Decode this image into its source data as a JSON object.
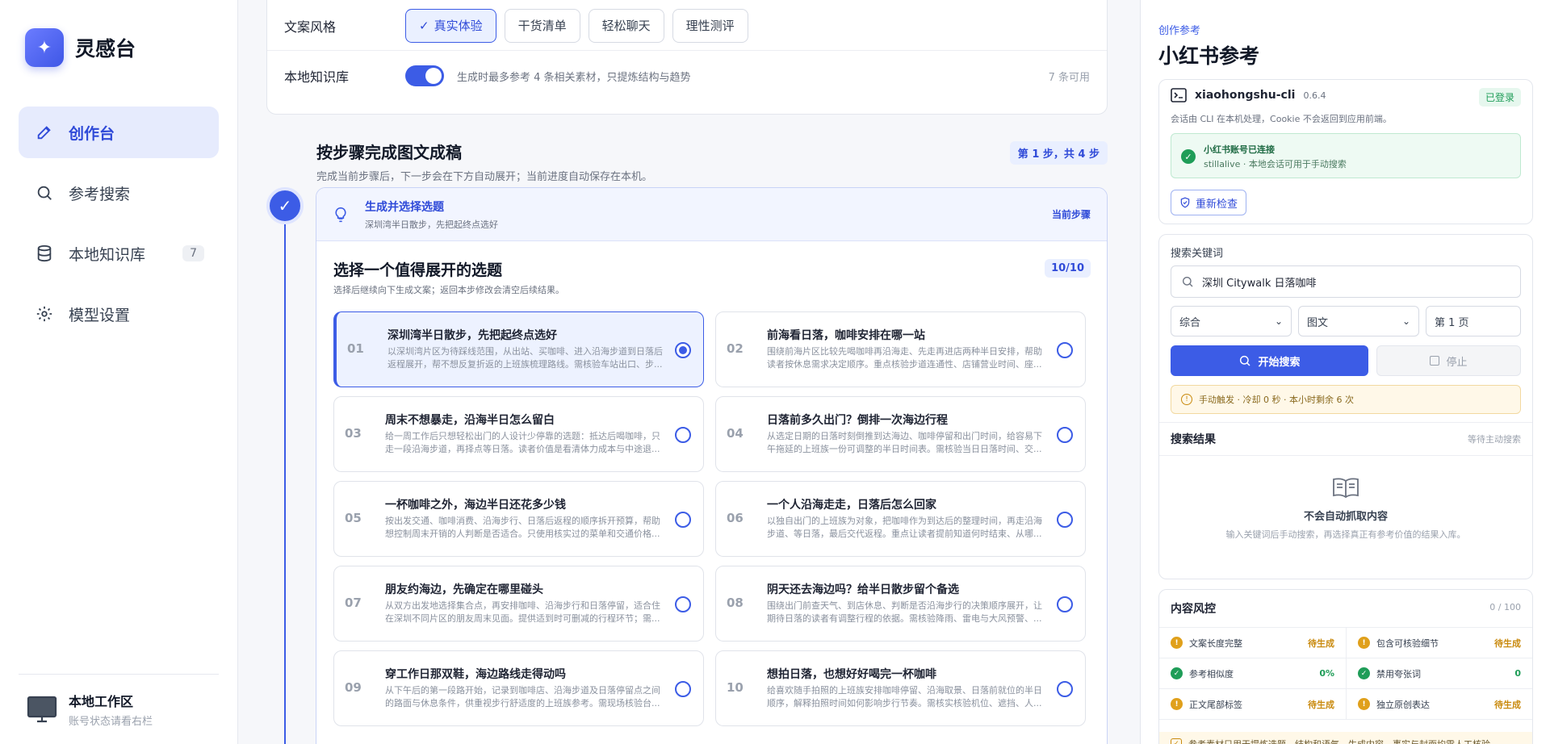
{
  "sidebar": {
    "brand": "灵感台",
    "items": [
      {
        "label": "创作台",
        "icon": "pencil-icon"
      },
      {
        "label": "参考搜索",
        "icon": "search-icon"
      },
      {
        "label": "本地知识库",
        "icon": "database-icon",
        "badge": "7"
      },
      {
        "label": "模型设置",
        "icon": "gear-icon"
      }
    ],
    "workspace": {
      "title": "本地工作区",
      "subtitle": "账号状态请看右栏"
    }
  },
  "settings": {
    "style_label": "文案风格",
    "style_options": [
      "真实体验",
      "干货清单",
      "轻松聊天",
      "理性测评"
    ],
    "style_selected": "真实体验",
    "kb_label": "本地知识库",
    "kb_enabled": true,
    "kb_desc": "生成时最多参考 4 条相关素材，只提炼结构与趋势",
    "kb_count": "7 条可用"
  },
  "steps": {
    "title": "按步骤完成图文成稿",
    "subtitle": "完成当前步骤后，下一步会在下方自动展开；当前进度自动保存在本机。",
    "badge": "第 1 步，共 4 步",
    "current": {
      "title": "生成并选择选题",
      "subtitle": "深圳湾半日散步，先把起终点选好",
      "status": "当前步骤"
    },
    "pick": {
      "title": "选择一个值得展开的选题",
      "subtitle": "选择后继续向下生成文案；返回本步修改会清空后续结果。",
      "count": "10/10"
    },
    "topics": [
      {
        "num": "01",
        "title": "深圳湾半日散步，先把起终点选好",
        "desc": "以深圳湾片区为待踩线范围，从出站、买咖啡、进入沿海步道到日落后返程展开，帮不想反复折返的上班族梳理路线。需核验车站出口、步...",
        "selected": true
      },
      {
        "num": "02",
        "title": "前海看日落，咖啡安排在哪一站",
        "desc": "围绕前海片区比较先喝咖啡再沿海走、先走再进店两种半日安排，帮助读者按休息需求决定顺序。重点核验步道连通性、店铺营业时间、座...",
        "selected": false
      },
      {
        "num": "03",
        "title": "周末不想暴走，沿海半日怎么留白",
        "desc": "给一周工作后只想轻松出门的人设计少停靠的选题：抵达后喝咖啡，只走一段沿海步道，再择点等日落。读者价值是看清体力成本与中途退...",
        "selected": false
      },
      {
        "num": "04",
        "title": "日落前多久出门？倒排一次海边行程",
        "desc": "从选定日期的日落时刻倒推到达海边、咖啡停留和出门时间，给容易下午拖延的上班族一份可调整的半日时间表。需核验当日日落时间、交...",
        "selected": false
      },
      {
        "num": "05",
        "title": "一杯咖啡之外，海边半日还花多少钱",
        "desc": "按出发交通、咖啡消费、沿海步行、日落后返程的顺序拆开预算，帮助想控制周末开销的人判断是否适合。只使用核实过的菜单和交通价格...",
        "selected": false
      },
      {
        "num": "06",
        "title": "一个人沿海走走，日落后怎么回家",
        "desc": "以独自出门的上班族为对象，把咖啡作为到达后的整理时间，再走沿海步道、等日落，最后交代返程。重点让读者提前知道何时结束、从哪...",
        "selected": false
      },
      {
        "num": "07",
        "title": "朋友约海边，先确定在哪里碰头",
        "desc": "从双方出发地选择集合点，再安排咖啡、沿海步行和日落停留，适合住在深圳不同片区的朋友周末见面。提供适到时可删减的行程环节；需...",
        "selected": false
      },
      {
        "num": "08",
        "title": "阴天还去海边吗？给半日散步留个备选",
        "desc": "围绕出门前查天气、到店休息、判断是否沿海步行的决策顺序展开，让期待日落的读者有调整行程的依据。需核验降雨、雷电与大风预警、...",
        "selected": false
      },
      {
        "num": "09",
        "title": "穿工作日那双鞋，海边路线走得动吗",
        "desc": "从下午后的第一段路开始，记录到咖啡店、沿海步道及日落停留点之间的路面与休息条件，供重视步行舒适度的上班族参考。需现场核验台...",
        "selected": false
      },
      {
        "num": "10",
        "title": "想拍日落，也想好好喝完一杯咖啡",
        "desc": "给喜欢随手拍照的上班族安排咖啡停留、沿海取景、日落前就位的半日顺序，解释拍照时间如何影响步行节奏。需核实核验机位、遮挡、人...",
        "selected": false
      }
    ]
  },
  "right": {
    "label": "创作参考",
    "title": "小红书参考",
    "cli": {
      "name": "xiaohongshu-cli",
      "version": "0.6.4",
      "badge": "已登录",
      "note": "会话由 CLI 在本机处理，Cookie 不会返回到应用前端。",
      "conn_title": "小红书账号已连接",
      "conn_sub": "stillalive · 本地会话可用于手动搜索",
      "recheck": "重新检查"
    },
    "search": {
      "label": "搜索关键词",
      "query": "深圳 Citywalk 日落咖啡",
      "sort": "综合",
      "type": "图文",
      "page": "第 1 页",
      "start": "开始搜索",
      "stop": "停止",
      "warn": "手动触发 · 冷却 0 秒 · 本小时剩余 6 次"
    },
    "results": {
      "title": "搜索结果",
      "status": "等待主动搜索",
      "empty_title": "不会自动抓取内容",
      "empty_sub": "输入关键词后手动搜索，再选择真正有参考价值的结果入库。"
    },
    "risk": {
      "title": "内容风控",
      "score": "0 / 100",
      "items": [
        {
          "label": "文案长度完整",
          "status": "待生成",
          "kind": "warn"
        },
        {
          "label": "包含可核验细节",
          "status": "待生成",
          "kind": "warn"
        },
        {
          "label": "参考相似度",
          "status": "0%",
          "kind": "ok"
        },
        {
          "label": "禁用夸张词",
          "status": "0",
          "kind": "ok"
        },
        {
          "label": "正文尾部标签",
          "status": "待生成",
          "kind": "warn"
        },
        {
          "label": "独立原创表达",
          "status": "待生成",
          "kind": "warn"
        }
      ],
      "footer": "参考素材只用于提炼选题、结构和语气。生成内容、事实与封面均需人工核验。"
    }
  },
  "colors": {
    "accent": "#3c5ce6",
    "success": "#1f9d58",
    "warning": "#e0a01b"
  }
}
